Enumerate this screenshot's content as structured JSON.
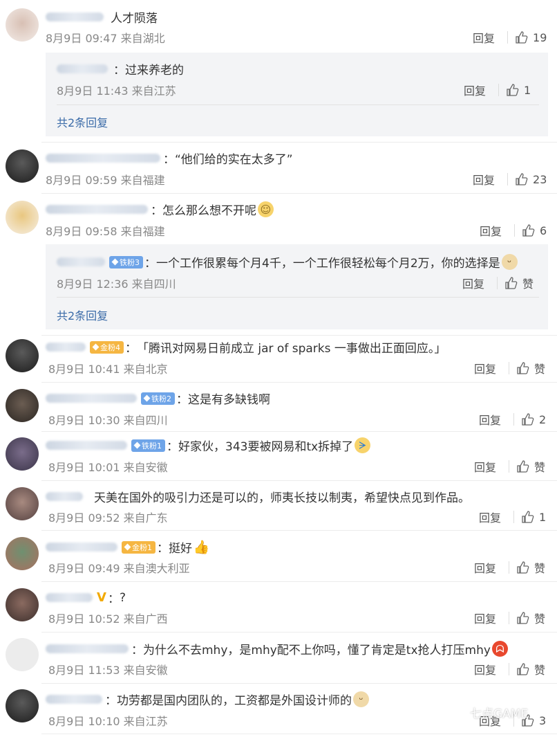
{
  "common": {
    "reply_label": "回复",
    "like_label": "赞"
  },
  "comments": [
    {
      "text": "人才陨落",
      "meta": "8月9日 09:47 来自湖北",
      "likes": "19",
      "sub": {
        "text": "过来养老的",
        "meta": "8月9日 11:43 来自江苏",
        "likes": "1",
        "more": "共2条回复"
      }
    },
    {
      "text": "“他们给的实在太多了”",
      "meta": "8月9日 09:59 来自福建",
      "likes": "23"
    },
    {
      "text": "怎么那么想不开呢",
      "meta": "8月9日 09:58 来自福建",
      "likes": "6",
      "sub": {
        "badge": "铁粉3",
        "text": "一个工作很累每个月4千，一个工作很轻松每个月2万，你的选择是",
        "meta": "8月9日 12:36 来自四川",
        "likes": "赞",
        "more": "共2条回复"
      }
    },
    {
      "badge": "金粉4",
      "text": "「腾讯对网易日前成立 jar of sparks 一事做出正面回应。」",
      "meta": "8月9日 10:41 来自北京",
      "likes": "赞"
    },
    {
      "badge": "铁粉2",
      "text": "这是有多缺钱啊",
      "meta": "8月9日 10:30 来自四川",
      "likes": "2"
    },
    {
      "badge": "铁粉1",
      "text": "好家伙，343要被网易和tx拆掉了",
      "meta": "8月9日 10:01 来自安徽",
      "likes": "赞"
    },
    {
      "text": "天美在国外的吸引力还是可以的，师夷长技以制夷，希望快点见到作品。",
      "meta": "8月9日 09:52 来自广东",
      "likes": "1"
    },
    {
      "badge": "金粉1",
      "text": "挺好",
      "meta": "8月9日 09:49 来自澳大利亚",
      "likes": "赞"
    },
    {
      "text": "?",
      "meta": "8月9日 10:52 来自广西",
      "likes": "赞"
    },
    {
      "text": "为什么不去mhy，是mhy配不上你吗，懂了肯定是tx抢人打压mhy",
      "meta": "8月9日 11:53 来自安徽",
      "likes": "赞"
    },
    {
      "text": "功劳都是国内团队的，工资都是外国设计师的",
      "meta": "8月9日 10:10 来自江苏",
      "likes": "3"
    }
  ],
  "watermark": "七点GAME"
}
